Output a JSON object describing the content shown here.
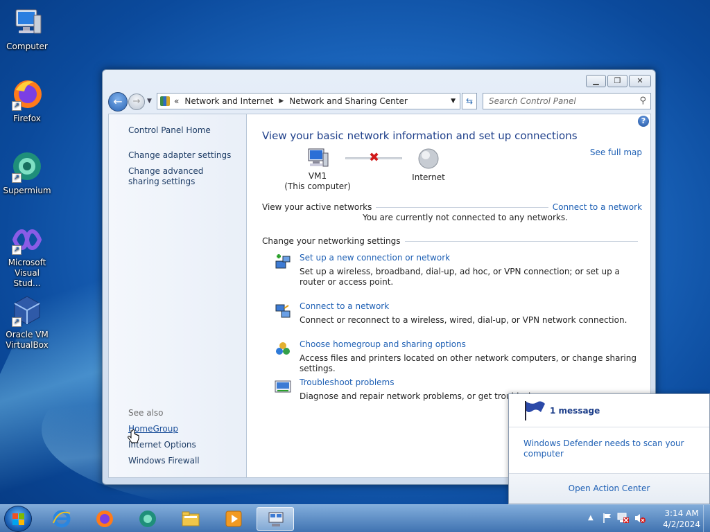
{
  "desktop": {
    "icons": [
      {
        "label": "Computer"
      },
      {
        "label": "Firefox"
      },
      {
        "label": "Supermium"
      },
      {
        "label": "Microsoft Visual Stud..."
      },
      {
        "label": "Oracle VM VirtualBox"
      }
    ]
  },
  "window": {
    "address": {
      "crumbs": [
        "Network and Internet",
        "Network and Sharing Center"
      ]
    },
    "search_placeholder": "Search Control Panel",
    "left": {
      "home": "Control Panel Home",
      "adapter": "Change adapter settings",
      "advanced": "Change advanced sharing settings",
      "see_also": "See also",
      "homegroup": "HomeGroup",
      "internet_options": "Internet Options",
      "firewall": "Windows Firewall"
    },
    "main": {
      "title": "View your basic network information and set up connections",
      "see_full_map": "See full map",
      "node_computer": "VM1",
      "node_computer_sub": "(This computer)",
      "node_internet": "Internet",
      "active_label": "View your active networks",
      "connect_link": "Connect to a network",
      "not_connected": "You are currently not connected to any networks.",
      "change_label": "Change your networking settings",
      "tasks": [
        {
          "title": "Set up a new connection or network",
          "desc": "Set up a wireless, broadband, dial-up, ad hoc, or VPN connection; or set up a router or access point."
        },
        {
          "title": "Connect to a network",
          "desc": "Connect or reconnect to a wireless, wired, dial-up, or VPN network connection."
        },
        {
          "title": "Choose homegroup and sharing options",
          "desc": "Access files and printers located on other network computers, or change sharing settings."
        },
        {
          "title": "Troubleshoot problems",
          "desc": "Diagnose and repair network problems, or get troublesho"
        }
      ]
    }
  },
  "popup": {
    "count": "1 message",
    "body": "Windows Defender needs to scan your computer",
    "footer": "Open Action Center"
  },
  "clock": {
    "time": "3:14 AM",
    "date": "4/2/2024"
  }
}
